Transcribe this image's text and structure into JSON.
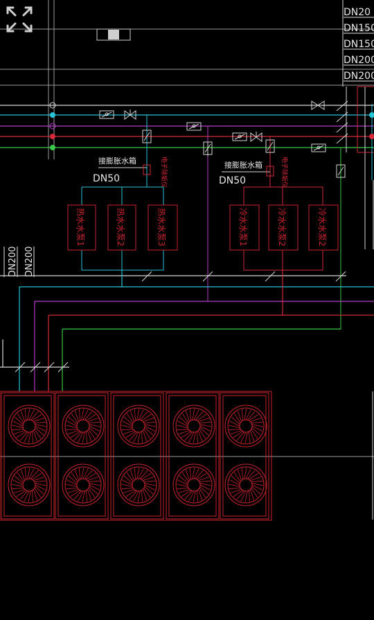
{
  "toolbar": {
    "expand_icon": "expand-icon"
  },
  "pipe_sizes_right": [
    "DN20",
    "DN150",
    "DN150",
    "DN200",
    "DN200"
  ],
  "pipe_sizes_left": [
    "DN200",
    "DN200"
  ],
  "expansion_tank_left": {
    "label": "接膨胀水箱",
    "size": "DN50",
    "valve": "电子除垢仪"
  },
  "expansion_tank_right": {
    "label": "接膨胀水箱",
    "size": "DN50",
    "valve": "电子除垢仪"
  },
  "hot_pumps": [
    "热水水泵1",
    "热水水泵2",
    "热水水泵3"
  ],
  "cold_pumps": [
    "冷水水泵1",
    "冷水水泵2",
    "冷水水泵2"
  ],
  "colors": {
    "background": "#000000",
    "white_pipe": "#d8d8d8",
    "cyan_pipe": "#29c4d8",
    "magenta_pipe": "#b43cc8",
    "red_pipe": "#d42a3a",
    "green_pipe": "#3ac84a",
    "equipment_red": "#c8242e",
    "text": "#e8e8e8"
  }
}
